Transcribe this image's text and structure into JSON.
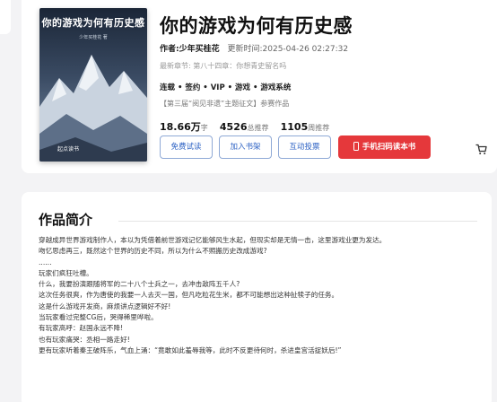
{
  "book": {
    "title": "你的游戏为何有历史感",
    "author_label": "作者:少年买桂花",
    "update_label": "更新时间:2025-04-26 02:27:32",
    "latest_chapter": "最新章节: 第八十四章：你想青史留名吗",
    "tags": "连载 • 签约 • VIP • 游戏 • 游戏系统",
    "event": "【第三届“阅见非遗”主题征文】参赛作品",
    "stats": [
      {
        "value": "18.66万",
        "label": "字"
      },
      {
        "value": "4526",
        "label": "总推荐"
      },
      {
        "value": "1105",
        "label": "周推荐"
      }
    ],
    "cover": {
      "title": "你的游戏为何有历史感",
      "author": "少年买桂花 著",
      "publisher": "起点读书"
    }
  },
  "actions": {
    "free_trial": "免费试读",
    "add_shelf": "加入书架",
    "vote": "互动投票",
    "scan_read": "手机扫码读本书"
  },
  "icons": {
    "cart": "shopping-cart-icon",
    "phone": "phone-icon"
  },
  "colors": {
    "primary_blue": "#2d62c4",
    "accent_red": "#e5383b"
  },
  "intro": {
    "heading": "作品简介",
    "paragraphs": [
      "穿越成异世界游戏制作人，本以为凭借着前世游戏记忆能够风生水起，但现实却是无情一击，这里游戏业更为发达。",
      "吻忆思虑再三，既然这个世界的历史不同，所以为什么不照搬历史改成游戏?",
      "......",
      "玩家们疯狂吐槽。",
      "什么，我要扮演跟随将军的二十八个士兵之一，去冲击敌阵五千人?",
      "这次任务很爽，作为唐使的我要一人去灭一国，但凡吃粒花生米，都不可能想出这种扯犊子的任务。",
      "这是什么游戏开发商，麻烦讲点逻辑好不好!",
      "当玩家看过完整CG后，哭得稀里哗啦。",
      "有玩家高呼：赵国永远不降!",
      "也有玩家痛哭：丞相一路走好!",
      "更有玩家听着秦王破阵乐，气血上涌：“竟敢如此羞辱我等，此时不反更待何时，杀进皇宫活捉妖后!”"
    ]
  }
}
